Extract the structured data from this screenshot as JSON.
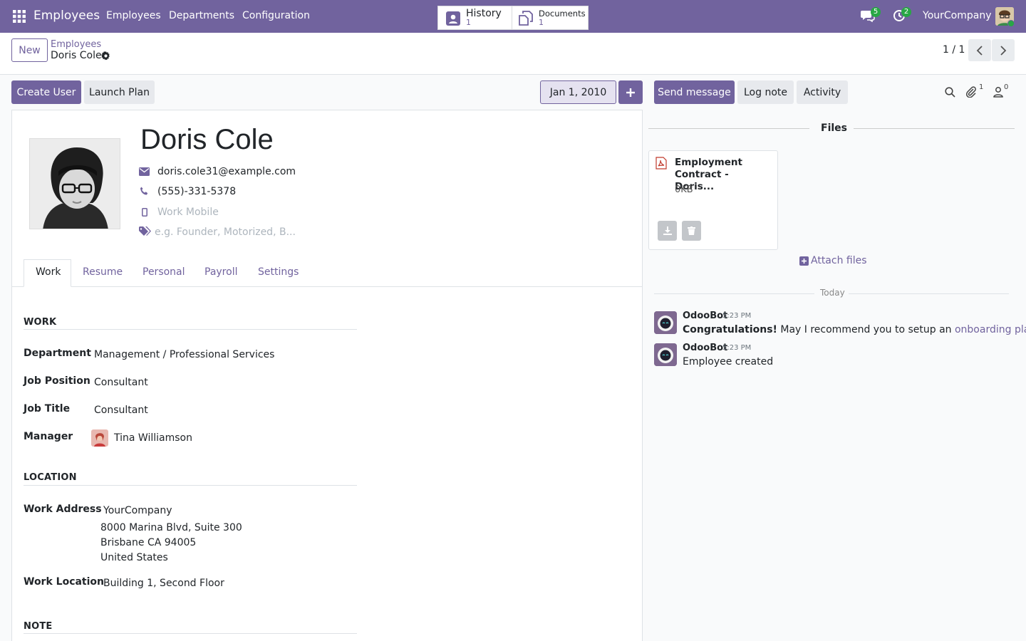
{
  "nav": {
    "app_title": "Employees",
    "menu": [
      "Employees",
      "Departments",
      "Configuration"
    ],
    "messages_count": "5",
    "activities_count": "2",
    "company": "YourCompany"
  },
  "control": {
    "new_label": "New",
    "breadcrumb_parent": "Employees",
    "breadcrumb_current": "Doris Cole",
    "history_label": "History",
    "history_count": "1",
    "documents_label": "Documents",
    "documents_count": "1",
    "pager": "1 / 1"
  },
  "statusbar": {
    "create_user": "Create User",
    "launch_plan": "Launch Plan",
    "date": "Jan 1, 2010"
  },
  "chatter_buttons": {
    "send_message": "Send message",
    "log_note": "Log note",
    "activity": "Activity",
    "attachments_count": "1",
    "followers_count": "0"
  },
  "employee": {
    "name": "Doris Cole",
    "email": "doris.cole31@example.com",
    "phone": "(555)-331-5378",
    "mobile_placeholder": "Work Mobile",
    "tags_placeholder": "e.g. Founder, Motorized, B..."
  },
  "tabs": [
    "Work",
    "Resume",
    "Personal",
    "Payroll",
    "Settings"
  ],
  "work": {
    "section_title": "WORK",
    "department_label": "Department",
    "department": "Management / Professional Services",
    "job_position_label": "Job Position",
    "job_position": "Consultant",
    "job_title_label": "Job Title",
    "job_title": "Consultant",
    "manager_label": "Manager",
    "manager": "Tina Williamson"
  },
  "location": {
    "section_title": "LOCATION",
    "work_address_label": "Work Address",
    "address_company": "YourCompany",
    "address_line1": "8000 Marina Blvd, Suite 300",
    "address_line2": "Brisbane CA 94005",
    "address_line3": "United States",
    "work_location_label": "Work Location",
    "work_location": "Building 1, Second Floor"
  },
  "note": {
    "section_title": "NOTE"
  },
  "files": {
    "title": "Files",
    "file_name": "Employment Contract - Doris...",
    "file_size": "0KB",
    "attach_label": "Attach files"
  },
  "chatter": {
    "divider": "Today",
    "messages": [
      {
        "author": "OdooBot",
        "time": "5:23 PM",
        "bold": "Congratulations!",
        "text": " May I recommend you to setup an ",
        "link": "onboarding plan?"
      },
      {
        "author": "OdooBot",
        "time": "5:23 PM",
        "text": "Employee created"
      }
    ]
  },
  "colors": {
    "brand": "#71639e",
    "badge": "#28a745"
  }
}
